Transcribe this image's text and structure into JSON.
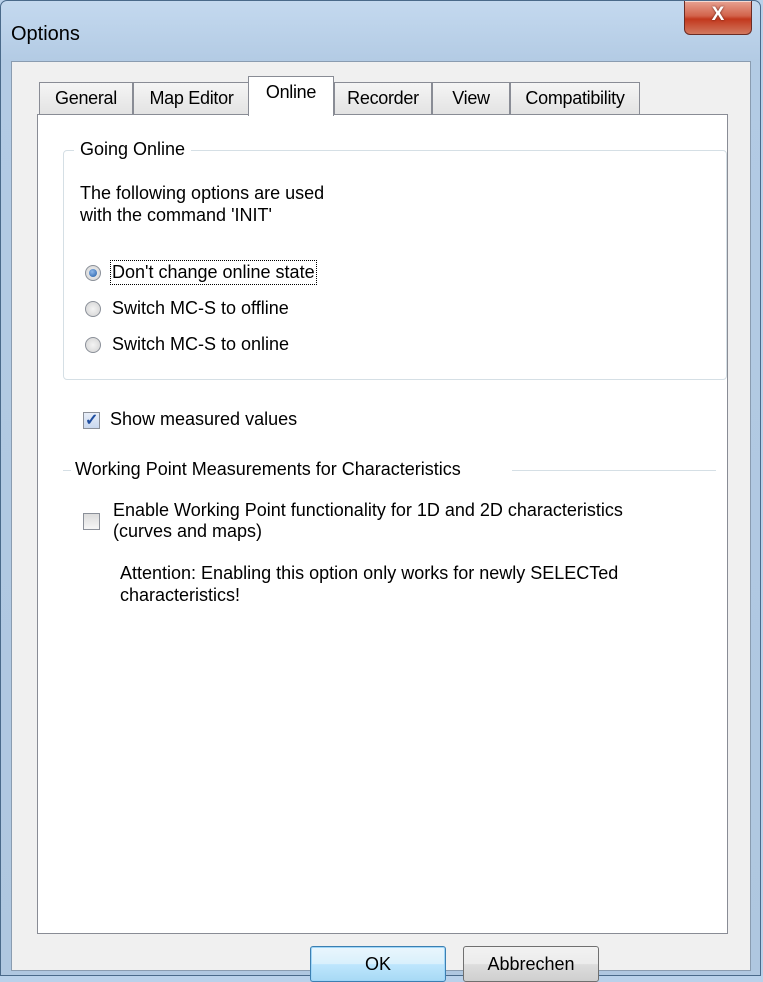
{
  "window": {
    "title": "Options",
    "close_label": "X"
  },
  "tabs": [
    {
      "label": "General"
    },
    {
      "label": "Map Editor"
    },
    {
      "label": "Online"
    },
    {
      "label": "Recorder"
    },
    {
      "label": "View"
    },
    {
      "label": "Compatibility"
    }
  ],
  "active_tab": "Online",
  "going_online": {
    "label": "Going Online",
    "description_line1": "The following options are used",
    "description_line2": "with the command 'INIT'",
    "options": [
      {
        "label": "Don't change online state",
        "checked": true
      },
      {
        "label": "Switch MC-S to offline",
        "checked": false
      },
      {
        "label": "Switch MC-S to online",
        "checked": false
      }
    ]
  },
  "show_measured": {
    "label": "Show measured values",
    "checked": true
  },
  "working_point": {
    "label": "Working Point Measurements for Characteristics",
    "checkbox_line1": "Enable Working Point functionality for 1D and 2D characteristics",
    "checkbox_line2": "(curves and maps)",
    "checked": false,
    "attention_line1": "Attention: Enabling this option only works for newly SELECTed",
    "attention_line2": "characteristics!"
  },
  "buttons": {
    "ok": "OK",
    "cancel": "Abbrechen"
  }
}
